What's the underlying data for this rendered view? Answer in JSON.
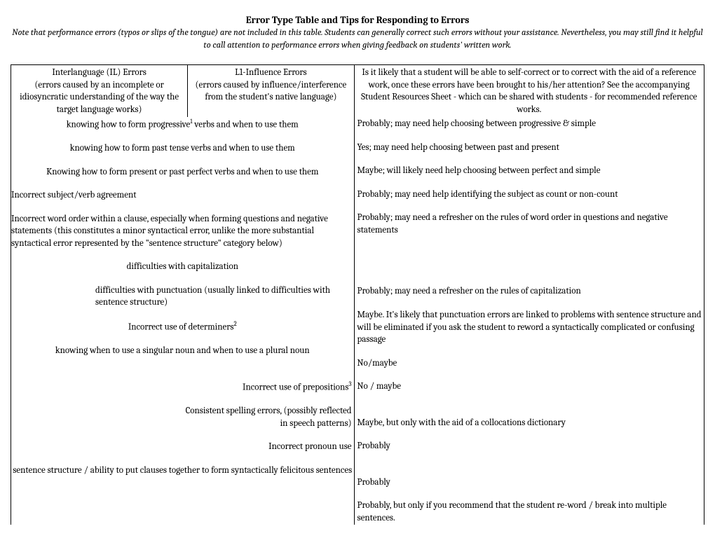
{
  "title": "Error Type Table and Tips for Responding to Errors",
  "note": "Note that performance errors (typos or slips of the tongue) are not included in this table. Students can generally correct such errors without your assistance. Nevertheless, you may still find it helpful to call attention to performance errors when giving feedback on students' written work.",
  "header": {
    "col1": {
      "title": "Interlanguage (IL) Errors",
      "subtitle": "(errors caused by an incomplete or idiosyncratic understanding of the way the target language works)"
    },
    "col2": {
      "title": "L1-Influence Errors",
      "subtitle": "(errors caused by influence/interference from the student's native language)"
    },
    "col3": "Is it likely that a student will be able to self-correct or to correct with the aid of a reference work, once these errors have been brought to his/her attention? See the accompanying Student Resources Sheet - which can be shared with students -  for recommended reference works."
  },
  "rows": {
    "r1a": "knowing how to form progressive",
    "r1b": " verbs and when to use them",
    "r1c": "Probably; may need help choosing between progressive & simple",
    "r2a": "knowing how to form past tense verbs and when to use them",
    "r2c": "Yes; may need help choosing between past and present",
    "r3a": "Knowing how to form present or past perfect verbs and when to use them",
    "r3c": "Maybe; will likely need help choosing between perfect and simple",
    "r4a": "Incorrect subject/verb agreement",
    "r4c": "Probably; may need help identifying the subject as count or non-count",
    "r5a": "Incorrect word order within a clause, especially when forming questions and negative statements (this constitutes a minor syntactical error, unlike the more substantial syntactical error represented by the \"sentence structure\" category below)",
    "r5c": "Probably; may need a refresher on the rules of word order in questions and negative statements",
    "r6a": "difficulties with capitalization",
    "r6c": "Probably; may need a refresher on the rules of capitalization",
    "r7a": "difficulties with punctuation (usually linked to difficulties with sentence structure)",
    "r7c": "Maybe. It's likely that punctuation errors are linked to problems with sentence structure and will be eliminated if you ask the student to reword a syntactically complicated or confusing passage",
    "r8a": "Incorrect use of determiners",
    "r8c": "No/maybe",
    "r9a": "knowing when to use a singular noun and when to use a plural noun",
    "r9c": "No / maybe",
    "r10a": "Incorrect use of prepositions",
    "r10c": "Maybe, but only with the aid of a collocations dictionary",
    "r11a": "Consistent spelling errors, (possibly reflected in speech patterns)",
    "r11c": "Probably",
    "r12a": "Incorrect pronoun use",
    "r12c": "Probably",
    "r13a": "sentence structure / ability to put clauses together to form syntactically felicitous sentences",
    "r13c": "Probably, but only if you recommend that the student re-word / break into multiple sentences."
  }
}
